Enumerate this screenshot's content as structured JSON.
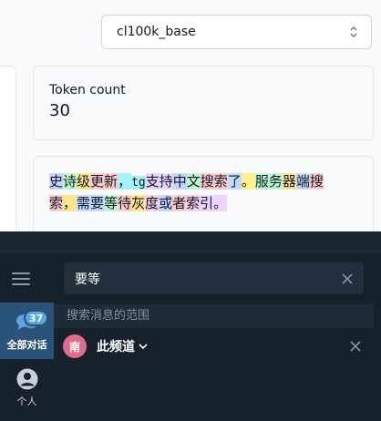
{
  "model_select": {
    "value": "cl100k_base"
  },
  "token_count": {
    "label": "Token count",
    "value": "30"
  },
  "tokens": [
    {
      "text": "史",
      "color": "#c7d2fe",
      "mono": false
    },
    {
      "text": "诗",
      "color": "#bbf7d0",
      "mono": false
    },
    {
      "text": "级",
      "color": "#fde68a",
      "mono": false
    },
    {
      "text": "更新",
      "color": "#fecaca",
      "mono": false
    },
    {
      "text": "，",
      "color": "#a5f3fc",
      "mono": false
    },
    {
      "text": "tg",
      "color": "#a5f3fc",
      "mono": true
    },
    {
      "text": "支持",
      "color": "#e9d5ff",
      "mono": false
    },
    {
      "text": "中",
      "color": "#c7d2fe",
      "mono": false
    },
    {
      "text": "文",
      "color": "#bbf7d0",
      "mono": false
    },
    {
      "text": "搜索",
      "color": "#fecaca",
      "mono": false
    },
    {
      "text": "了",
      "color": "#bfdbfe",
      "mono": false
    },
    {
      "text": "。",
      "color": "#fef08a",
      "mono": false
    },
    {
      "text": "服务",
      "color": "#bbf7d0",
      "mono": false
    },
    {
      "text": "器",
      "color": "#fde68a",
      "mono": false
    },
    {
      "text": "端",
      "color": "#bfdbfe",
      "mono": false
    },
    {
      "text": "搜",
      "color": "#fecaca",
      "mono": false
    },
    {
      "text": "索",
      "color": "#fecaca",
      "mono": false
    },
    {
      "text": "，",
      "color": "#fde68a",
      "mono": false
    },
    {
      "text": "需要",
      "color": "#bfdbfe",
      "mono": false
    },
    {
      "text": "等",
      "color": "#bbf7d0",
      "mono": false
    },
    {
      "text": "待",
      "color": "#fecaca",
      "mono": false
    },
    {
      "text": "灰",
      "color": "#fde68a",
      "mono": false
    },
    {
      "text": "度",
      "color": "#fbcfe8",
      "mono": false
    },
    {
      "text": "或",
      "color": "#c7d2fe",
      "mono": false
    },
    {
      "text": "者",
      "color": "#fecaca",
      "mono": false
    },
    {
      "text": "索",
      "color": "#fbcfe8",
      "mono": false
    },
    {
      "text": "引",
      "color": "#e9d5ff",
      "mono": false
    },
    {
      "text": "。",
      "color": "#e9d5ff",
      "mono": false
    }
  ],
  "chat": {
    "search": {
      "value": "要等"
    },
    "scope_label": "搜索消息的范围",
    "channel": {
      "avatar": "南",
      "label": "此频道"
    },
    "sidebar": [
      {
        "label": "全部对话",
        "badge": "37",
        "icon": "chat-bubbles-icon"
      },
      {
        "label": "个人",
        "icon": "person-icon"
      }
    ]
  },
  "colors": {
    "overlay_bg": "#17212b",
    "active_folder": "#2b5278",
    "badge": "#5ca7dd",
    "avatar": "#e06c8b"
  }
}
